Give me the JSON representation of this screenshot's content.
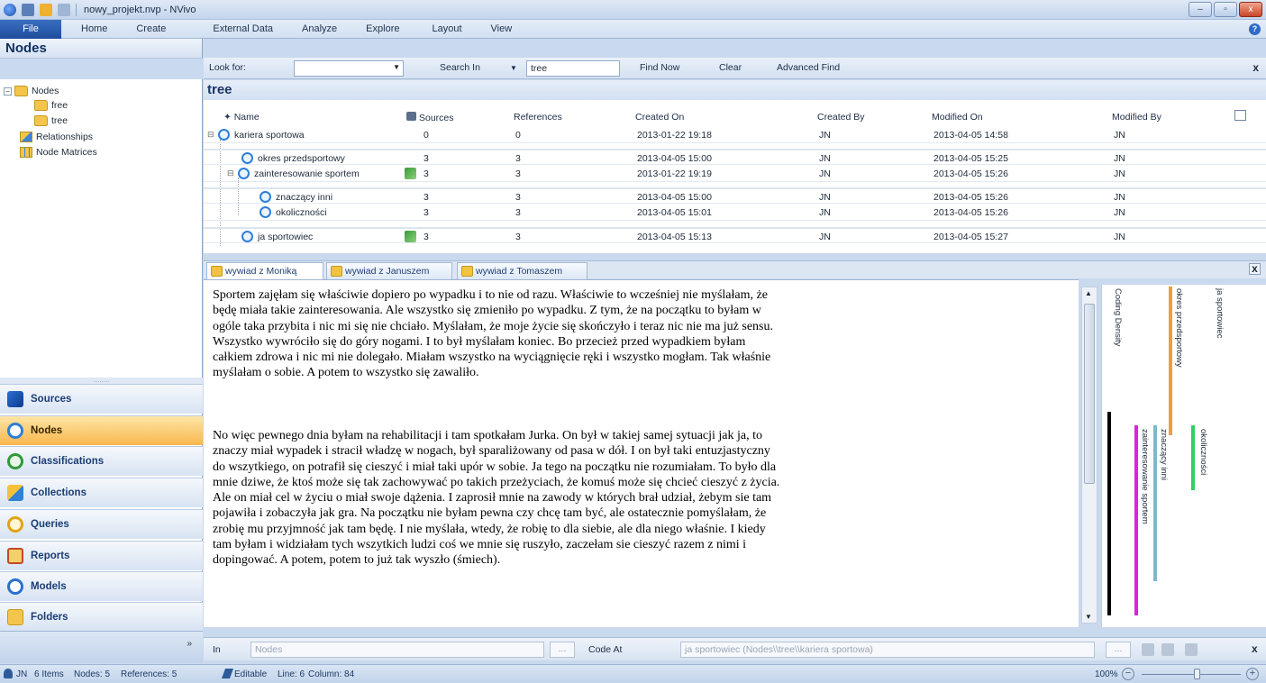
{
  "window": {
    "title": "nowy_projekt.nvp - NVivo",
    "controls": [
      "–",
      "▫",
      "x"
    ]
  },
  "ribbon": {
    "file": "File",
    "tabs": [
      "Home",
      "Create",
      "External Data",
      "Analyze",
      "Explore",
      "Layout",
      "View"
    ]
  },
  "nav": {
    "header": "Nodes",
    "tree": [
      {
        "label": "Nodes",
        "expander": "−"
      },
      {
        "label": "free"
      },
      {
        "label": "tree"
      },
      {
        "label": "Relationships"
      },
      {
        "label": "Node Matrices"
      }
    ],
    "grip": "........",
    "buttons": [
      "Sources",
      "Nodes",
      "Classifications",
      "Collections",
      "Queries",
      "Reports",
      "Models",
      "Folders"
    ],
    "more": "»",
    "colors": {
      "active": "#f8b64c"
    }
  },
  "search": {
    "look_for_label": "Look for:",
    "look_for_value": "",
    "search_in_label": "Search In",
    "search_in_value": "tree",
    "find_now": "Find Now",
    "clear": "Clear",
    "advanced_find": "Advanced Find",
    "close": "x"
  },
  "list": {
    "title": "tree",
    "columns": [
      "Name",
      "Sources",
      "References",
      "Created On",
      "Created By",
      "Modified On",
      "Modified By"
    ],
    "rows": [
      {
        "name": "kariera sportowa",
        "sources": "0",
        "references": "0",
        "created_on": "2013-01-22 19:18",
        "created_by": "JN",
        "modified_on": "2013-04-05 14:58",
        "modified_by": "JN"
      },
      {
        "name": "okres przedsportowy",
        "sources": "3",
        "references": "3",
        "created_on": "2013-04-05 15:00",
        "created_by": "JN",
        "modified_on": "2013-04-05 15:25",
        "modified_by": "JN"
      },
      {
        "name": "zainteresowanie sportem",
        "sources": "3",
        "references": "3",
        "created_on": "2013-01-22 19:19",
        "created_by": "JN",
        "modified_on": "2013-04-05 15:26",
        "modified_by": "JN"
      },
      {
        "name": "znaczący inni",
        "sources": "3",
        "references": "3",
        "created_on": "2013-04-05 15:00",
        "created_by": "JN",
        "modified_on": "2013-04-05 15:26",
        "modified_by": "JN"
      },
      {
        "name": "okoliczności",
        "sources": "3",
        "references": "3",
        "created_on": "2013-04-05 15:01",
        "created_by": "JN",
        "modified_on": "2013-04-05 15:26",
        "modified_by": "JN"
      },
      {
        "name": "ja sportowiec",
        "sources": "3",
        "references": "3",
        "created_on": "2013-04-05 15:13",
        "created_by": "JN",
        "modified_on": "2013-04-05 15:27",
        "modified_by": "JN"
      }
    ]
  },
  "doc": {
    "tabs": [
      "wywiad z Moniką",
      "wywiad z Januszem",
      "wywiad z Tomaszem"
    ],
    "close": "x",
    "paragraphs": [
      "Sportem zajęłam się właściwie dopiero po wypadku i to nie od razu. Właściwie to wcześniej nie myślałam, że będę miała takie zainteresowania. Ale wszystko się zmieniło po wypadku. Z tym, że na początku to byłam w ogóle taka przybita i nic mi się nie chciało. Myślałam, że moje życie się skończyło i teraz nic nie ma już sensu. Wszystko wywróciło się do góry nogami. I to był myślałam koniec. Bo przecież przed wypadkiem byłam całkiem zdrowa i nic mi nie dolegało. Miałam wszystko na wyciągnięcie ręki i wszystko mogłam. Tak właśnie myślałam o sobie. A potem to wszystko się zawaliło.",
      "No więc pewnego dnia byłam na rehabilitacji i tam spotkałam Jurka. On był w takiej samej sytuacji jak ja, to znaczy miał wypadek i stracił władzę w nogach, był sparaliżowany od pasa w dół. I on był taki entuzjastyczny do wszytkiego, on potrafił się cieszyć i miał taki upór w sobie. Ja tego na początku nie rozumiałam. To było dla mnie dziwe, że ktoś może się tak zachowywać po takich przeżyciach, że komuś może się chcieć cieszyć z życia. Ale on miał cel w życiu o miał swoje dążenia. I zaprosił mnie na zawody w których brał udział, żebym sie tam pojawiła i zobaczyła jak gra. Na początku nie byłam pewna czy chcę tam być, ale ostatecznie pomyślałam, że zrobię mu przyjmność jak tam będę. I nie myślała, wtedy, że robię to dla siebie, ale dla niego właśnie. I kiedy tam byłam i widziałam tych wszytkich ludzi coś we mnie się ruszyło, zaczełam sie cieszyć razem z nimi i dopingować. A potem, potem to już tak wyszło (śmiech)."
    ]
  },
  "stripes": {
    "items": [
      {
        "label": "Coding Density",
        "color": "#000000",
        "from": 0.37,
        "to": 0.97
      },
      {
        "label": "okres przedsportowy",
        "color": "#f0a030",
        "from": 0.0,
        "to": 0.44
      },
      {
        "label": "ja sportowiec",
        "color": "#ffffff",
        "from": 0.0,
        "to": 0.0
      },
      {
        "label": "zainteresowanie sportem",
        "color": "#e020e0",
        "from": 0.41,
        "to": 0.97
      },
      {
        "label": "znaczący inni",
        "color": "#7fb8cc",
        "from": 0.41,
        "to": 0.87
      },
      {
        "label": "okoliczności",
        "color": "#30d060",
        "from": 0.41,
        "to": 0.6
      }
    ]
  },
  "coding": {
    "in_label": "In",
    "in_value": "Nodes",
    "dots": "...",
    "code_at_label": "Code At",
    "code_at_value": "ja sportowiec (Nodes\\\\tree\\\\kariera sportowa)",
    "close": "x"
  },
  "status": {
    "user": "JN",
    "items": "6 Items",
    "nodes": "Nodes: 5",
    "references": "References: 5",
    "editable": "Editable",
    "line": "Line: 6",
    "column": "Column: 84",
    "zoom": "100%",
    "zoom_level": 0.55
  }
}
